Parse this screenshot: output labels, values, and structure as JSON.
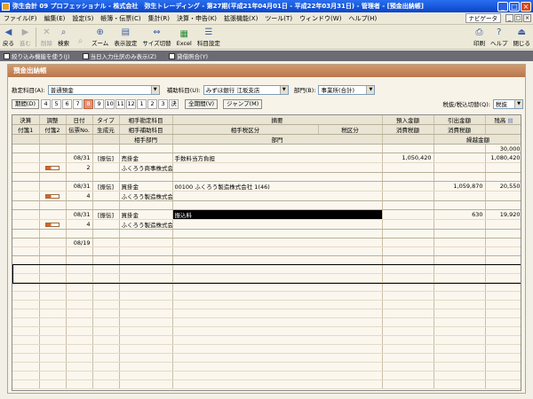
{
  "window": {
    "title": "弥生会計 09 プロフェッショナル - 株式会社　弥生トレーディング - 第27期(平成21年04月01日 - 平成22年03月31日) - 管理者 - [預金出納帳]",
    "min": "_",
    "max": "□",
    "close": "×"
  },
  "menu": {
    "items": [
      "ファイル(F)",
      "編集(E)",
      "設定(S)",
      "帳簿・伝票(C)",
      "集計(R)",
      "決算・申告(K)",
      "拡張機能(X)",
      "ツール(T)",
      "ウィンドウ(W)",
      "ヘルプ(H)"
    ],
    "navi": "ナビゲータ"
  },
  "toolbar": {
    "back": "戻る",
    "forward": "進む",
    "delete": "削除",
    "search": "検索",
    "search_icon_alt": "",
    "zoom": "ズーム",
    "view": "表示設定",
    "size": "サイズ切替",
    "excel": "Excel",
    "accounts": "科目設定",
    "print": "印刷",
    "help": "ヘルプ",
    "close": "閉じる"
  },
  "options": {
    "opt1": "絞り込み機能を使う(J)",
    "opt2": "当日入力仕訳のみ表示(Z)",
    "opt3": "貸借照合(Y)"
  },
  "panel": {
    "title": "預金出納帳",
    "account_label": "勘定科目(A):",
    "account_value": "普通預金",
    "sub_label": "補助科目(U):",
    "sub_value": "みずほ銀行 江坂支店",
    "dept_label": "部門(B):",
    "dept_value": "事業所(合計)",
    "period_button": "期間(D)",
    "months": [
      "4",
      "5",
      "6",
      "7",
      "8",
      "9",
      "10",
      "11",
      "12",
      "1",
      "2",
      "3",
      "決"
    ],
    "active_month": "8",
    "all_period": "全期間(V)",
    "jump": "ジャンプ(M)",
    "tax_label": "税抜/税込切替(Q):",
    "tax_value": "税抜"
  },
  "grid": {
    "h1": [
      "決算",
      "調整",
      "日付",
      "タイプ",
      "相手勘定科目",
      "摘要",
      "預入金額",
      "引出金額",
      "残高"
    ],
    "h2": [
      "付箋1",
      "付箋2",
      "伝票No.",
      "生成元",
      "相手補助科目",
      "相手税区分",
      "税区分",
      "消費税額",
      "消費税額"
    ],
    "h3": [
      "相手部門",
      "部門",
      "繰越金額"
    ],
    "carryover": "30,000",
    "entries": [
      {
        "date": "08/31",
        "no": "2",
        "type": "[振伝]",
        "account": "売掛金",
        "sub": "ふくろう商事株式会",
        "memo": "手数料当方負担",
        "deposit": "1,050,420",
        "withdraw": "",
        "balance": "1,080,420",
        "flag": true
      },
      {
        "date": "08/31",
        "no": "4",
        "type": "[振伝]",
        "account": "買掛金",
        "sub": "ふくろう製造株式会",
        "memo": "00100 ふくろう製造株式会社 1(46)",
        "deposit": "",
        "withdraw": "1,059,870",
        "balance": "20,550",
        "flag": true
      },
      {
        "date": "08/31",
        "no": "4",
        "type": "[振伝]",
        "account": "買掛金",
        "sub": "ふくろう製造株式会",
        "memo": "振込料",
        "deposit": "",
        "withdraw": "630",
        "balance": "19,920",
        "flag": true
      },
      {
        "date": "08/19",
        "no": "",
        "type": "",
        "account": "",
        "sub": "",
        "memo": "",
        "deposit": "",
        "withdraw": "",
        "balance": "",
        "flag": false
      }
    ]
  }
}
